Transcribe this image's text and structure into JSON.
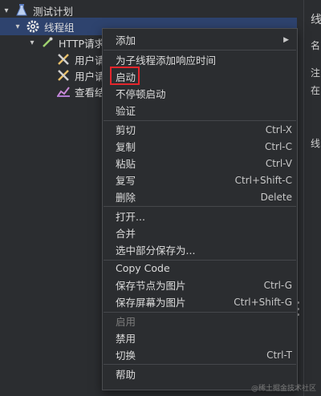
{
  "tree": {
    "test_plan": "测试计划",
    "thread_group": "线程组",
    "http_request": "HTTP请求",
    "user_param_1": "用户请",
    "user_param_2": "用户请",
    "view_results": "查看结"
  },
  "right_panel": {
    "chars": [
      "线",
      "名",
      "注",
      "在",
      "线"
    ]
  },
  "context_menu": {
    "items": [
      {
        "label": "添加",
        "shortcut": "",
        "submenu": true
      },
      {
        "label": "为子线程添加响应时间",
        "shortcut": ""
      },
      {
        "label": "启动",
        "shortcut": ""
      },
      {
        "label": "不停顿启动",
        "shortcut": ""
      },
      {
        "label": "验证",
        "shortcut": ""
      },
      {
        "label": "剪切",
        "shortcut": "Ctrl-X"
      },
      {
        "label": "复制",
        "shortcut": "Ctrl-C"
      },
      {
        "label": "粘贴",
        "shortcut": "Ctrl-V"
      },
      {
        "label": "复写",
        "shortcut": "Ctrl+Shift-C"
      },
      {
        "label": "删除",
        "shortcut": "Delete"
      },
      {
        "label": "打开...",
        "shortcut": ""
      },
      {
        "label": "合并",
        "shortcut": ""
      },
      {
        "label": "选中部分保存为...",
        "shortcut": ""
      },
      {
        "label": "Copy Code",
        "shortcut": ""
      },
      {
        "label": "保存节点为图片",
        "shortcut": "Ctrl-G"
      },
      {
        "label": "保存屏幕为图片",
        "shortcut": "Ctrl+Shift-G"
      },
      {
        "label": "启用",
        "shortcut": "",
        "disabled": true
      },
      {
        "label": "禁用",
        "shortcut": ""
      },
      {
        "label": "切换",
        "shortcut": "Ctrl-T"
      },
      {
        "label": "帮助",
        "shortcut": ""
      }
    ]
  },
  "watermark": "@稀土掘金技术社区",
  "colors": {
    "selection": "#2e436e",
    "highlight_border": "#e4262c",
    "background": "#2b2d30"
  }
}
